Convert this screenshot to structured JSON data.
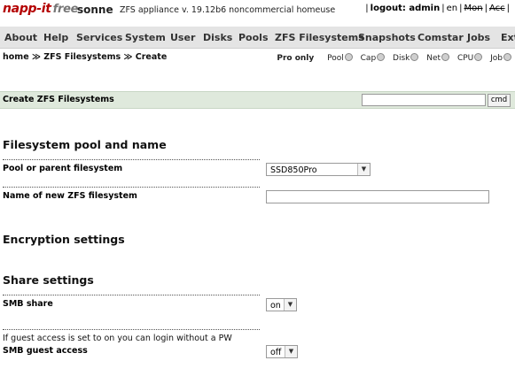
{
  "header": {
    "logo": "napp-it",
    "logo_suffix": "free",
    "hostname": "sonne",
    "appliance_info": "ZFS appliance v. 19.12b6 noncommercial homeuse",
    "logout": "logout: admin",
    "lang": "en",
    "mon": "Mon",
    "acc": "Acc"
  },
  "menu": {
    "items": [
      "About",
      "Help",
      "Services",
      "System",
      "User",
      "Disks",
      "Pools",
      "ZFS Filesystems",
      "Snapshots",
      "Comstar",
      "Jobs",
      "Ext"
    ]
  },
  "breadcrumb": {
    "text": "home ≫ ZFS Filesystems ≫ Create"
  },
  "monitors": {
    "pro_only": "Pro only",
    "items": [
      "Pool",
      "Cap",
      "Disk",
      "Net",
      "CPU",
      "Job"
    ]
  },
  "section": {
    "title": "Create ZFS Filesystems",
    "cmd_value": "",
    "cmd_label": "cmd"
  },
  "form": {
    "pool_heading": "Filesystem pool and name",
    "pool_label": "Pool or parent filesystem",
    "pool_value": "SSD850Pro",
    "name_label": "Name of new ZFS filesystem",
    "name_value": "",
    "encryption_heading": "Encryption settings",
    "share_heading": "Share settings",
    "smb_label": "SMB share",
    "smb_value": "on",
    "guest_note": "If guest access is set to on you can login without a PW",
    "guest_label": "SMB guest access",
    "guest_value": "off"
  }
}
